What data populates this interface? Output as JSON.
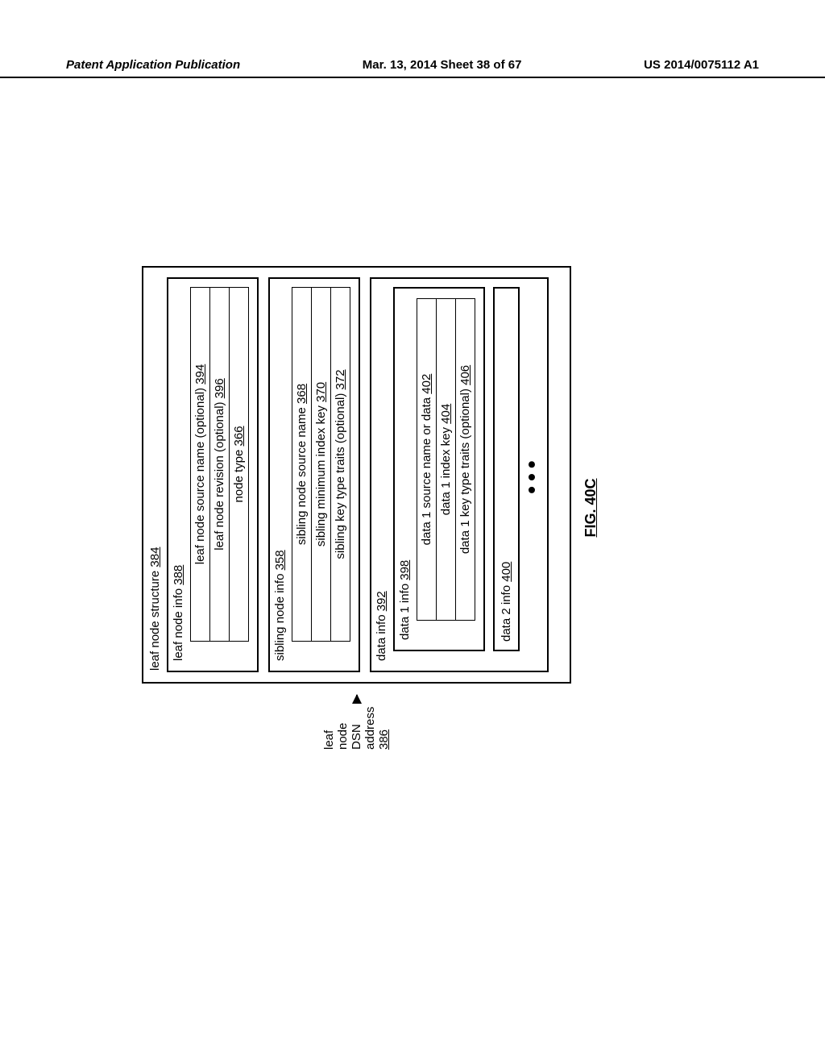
{
  "header": {
    "left": "Patent Application Publication",
    "center": "Mar. 13, 2014  Sheet 38 of 67",
    "right": "US 2014/0075112 A1"
  },
  "figure_label": "FIG. 40C",
  "dsn": {
    "label": "leaf node DSN address",
    "ref": "386"
  },
  "outer": {
    "label": "leaf node structure",
    "ref": "384"
  },
  "section_a": {
    "title_label": "leaf node info",
    "title_ref": "388",
    "row1_label": "leaf node source name (optional)",
    "row1_ref": "394",
    "row2_label": "leaf node revision (optional)",
    "row2_ref": "396",
    "row3_label": "node type",
    "row3_ref": "366"
  },
  "section_b": {
    "title_label": "sibling node info",
    "title_ref": "358",
    "row1_label": "sibling node source name",
    "row1_ref": "368",
    "row2_label": "sibling minimum index key",
    "row2_ref": "370",
    "row3_label": "sibling key type traits (optional)",
    "row3_ref": "372"
  },
  "section_c": {
    "title_label": "data info",
    "title_ref": "392",
    "nested1": {
      "title_label": "data 1 info",
      "title_ref": "398",
      "row1_label": "data 1 source name or data",
      "row1_ref": "402",
      "row2_label": "data 1 index key",
      "row2_ref": "404",
      "row3_label": "data 1 key type traits (optional)",
      "row3_ref": "406"
    },
    "nested2": {
      "title_label": "data 2 info",
      "title_ref": "400"
    }
  }
}
